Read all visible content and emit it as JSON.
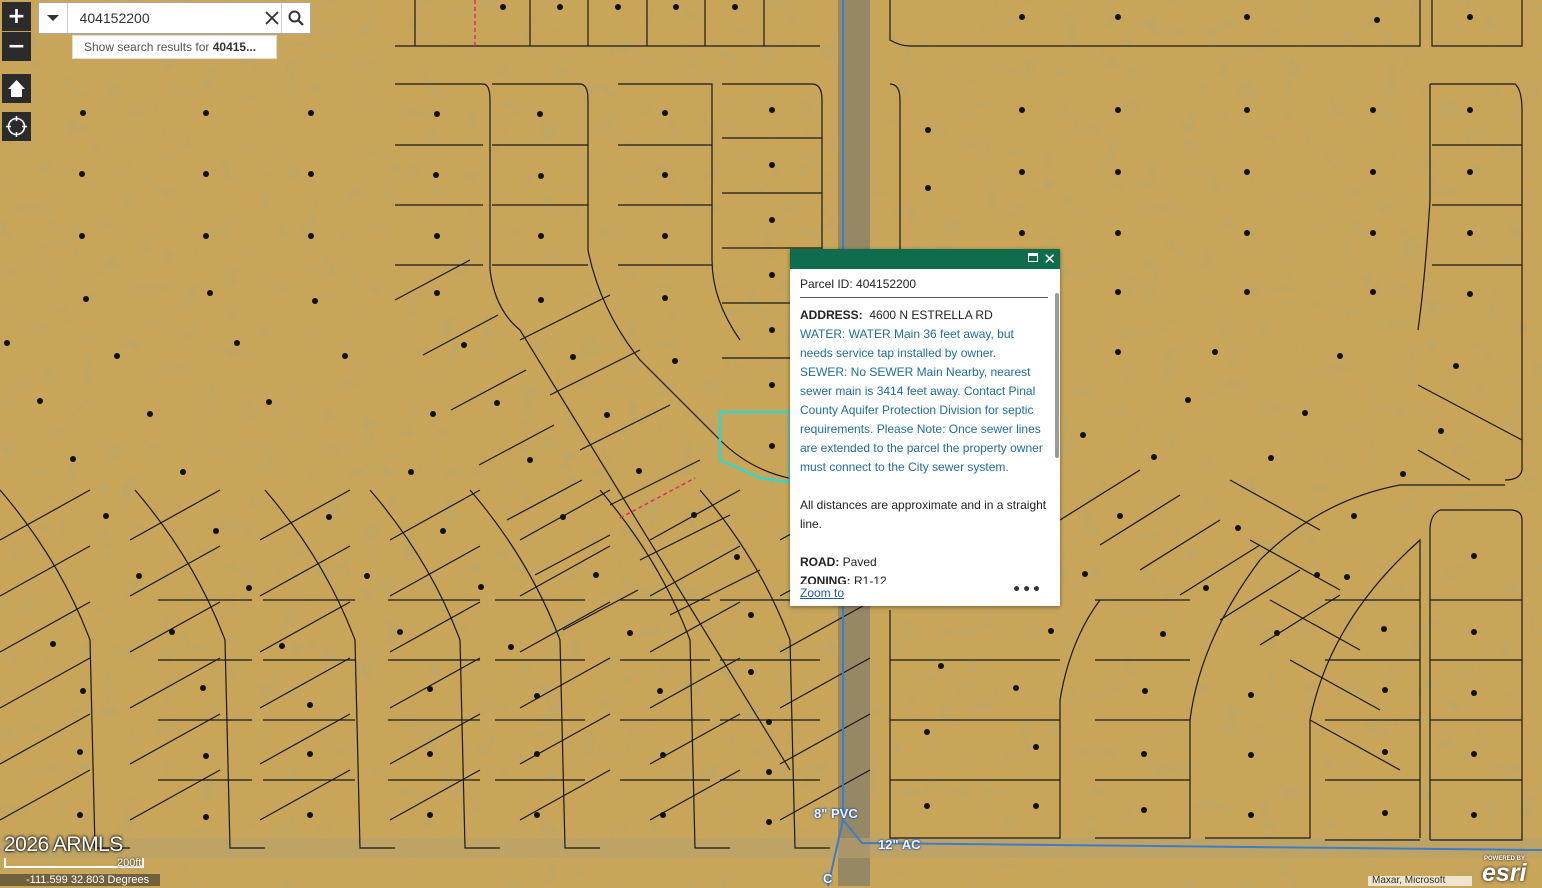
{
  "search": {
    "value": "404152200",
    "suggest_prefix": "Show search results for ",
    "suggest_bold": "40415..."
  },
  "zoom": {
    "in": "+",
    "out": "−"
  },
  "icons": {
    "dropdown": "chevron-down-icon",
    "clear": "close-icon",
    "search": "search-icon",
    "home": "home-icon",
    "locate": "locate-icon",
    "maximize": "maximize-icon",
    "close": "close-icon",
    "more": "ellipsis-icon"
  },
  "popup": {
    "title": "Parcel ID: 404152200",
    "address_label": "ADDRESS:",
    "address_value": "4600 N ESTRELLA RD",
    "water": "WATER: WATER Main 36 feet away, but needs service tap installed by owner.",
    "sewer": "SEWER: No SEWER Main Nearby, nearest sewer main is 3414 feet away. Contact Pinal County Aquifer Protection Division for septic requirements. Please Note: Once sewer lines are extended to the parcel the property owner must connect to the City sewer system.",
    "note": "All distances are approximate and in a straight line.",
    "road_label": "ROAD:",
    "road_value": "Paved",
    "zoning_label": "ZONING:",
    "zoning_value": "R1-12",
    "zoom_to": "Zoom to",
    "more": "•••",
    "close": "✕"
  },
  "map_labels": {
    "pipe_1": "8\" PVC",
    "pipe_2": "12\" AC",
    "pipe_3": "C"
  },
  "colors": {
    "ground": "#c9a55a",
    "parcel_line": "#1a1a1a",
    "water_line": "#3a7dc8",
    "selected": "#35d6c8",
    "popup_header": "#0f6d4e",
    "link": "#1f6d9b"
  },
  "footer": {
    "copyright": "2026 ARMLS",
    "scale": "200ft",
    "coords": "-111.599 32.803 Degrees",
    "attribution": "Maxar, Microsoft",
    "esri_powered": "POWERED BY",
    "esri": "esri"
  }
}
